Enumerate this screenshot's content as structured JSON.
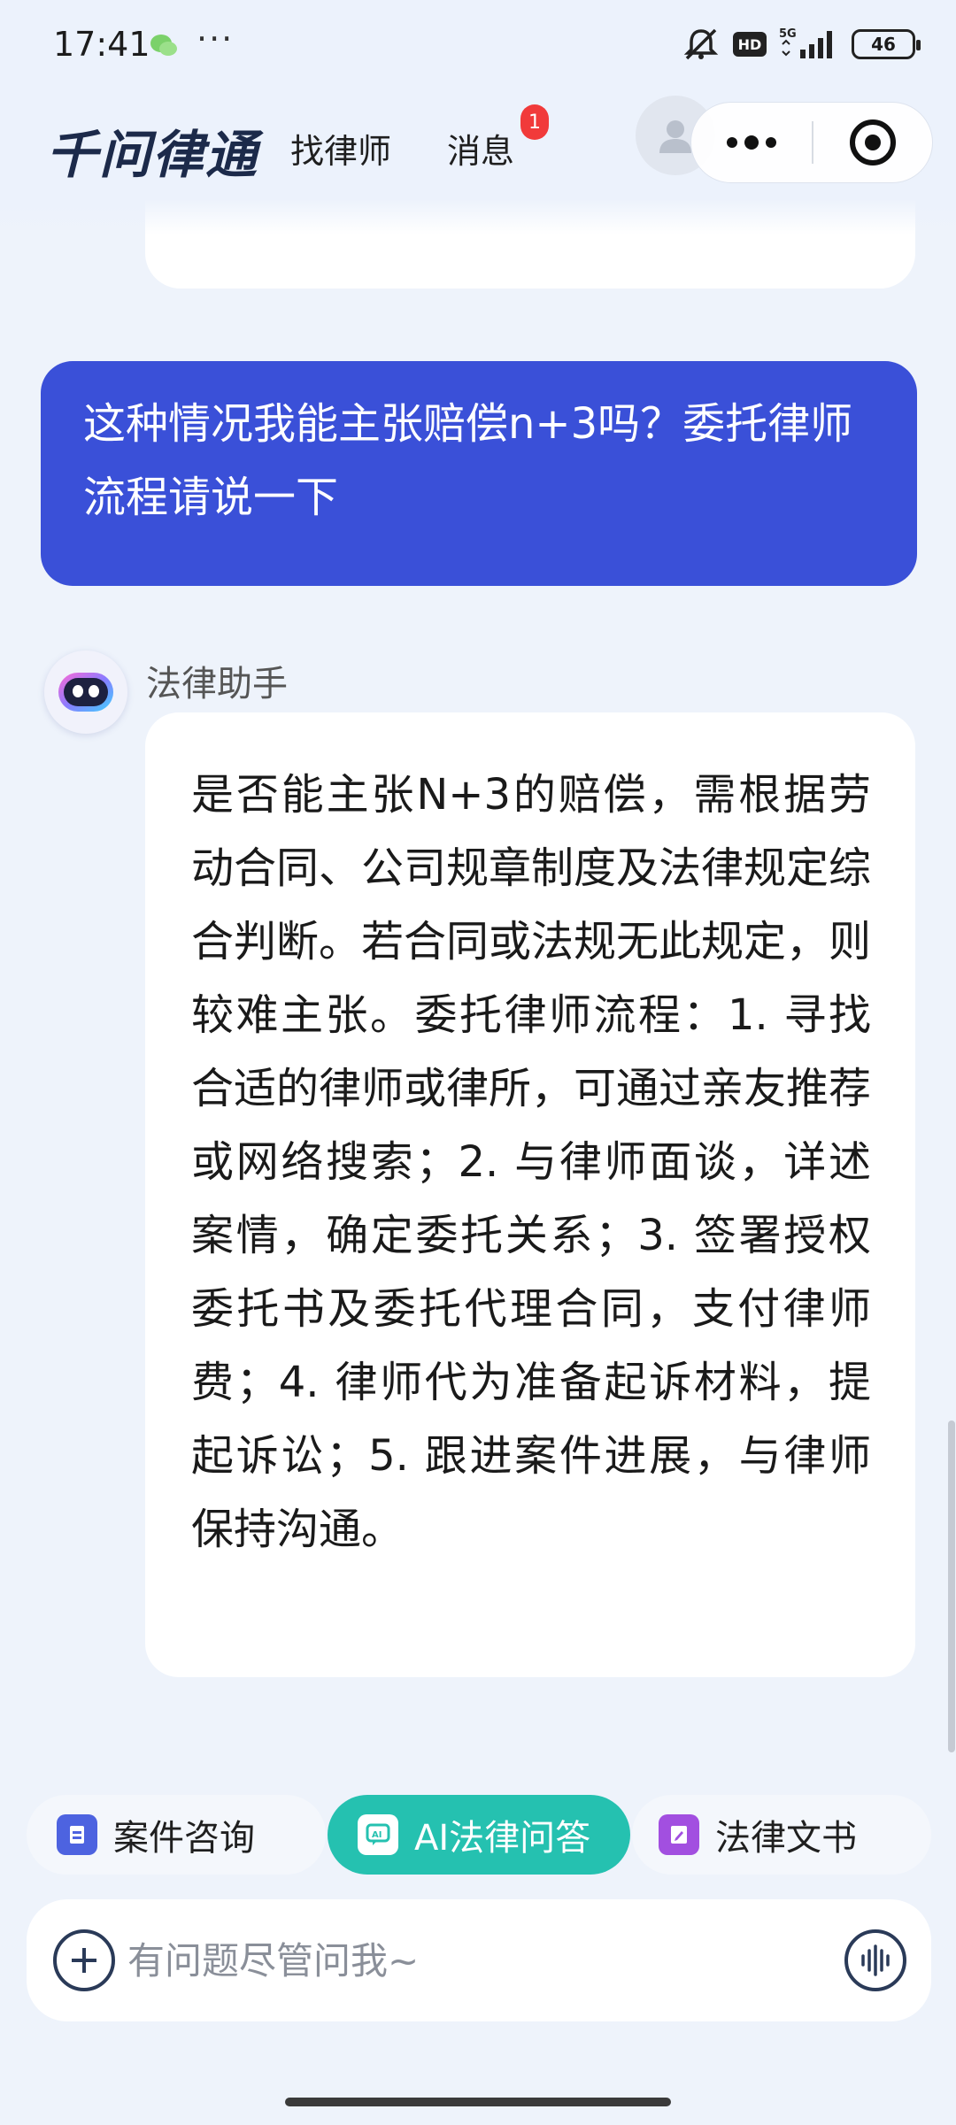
{
  "status_bar": {
    "time": "17:41",
    "dots": "···",
    "network": "5G",
    "hd": "HD",
    "battery": "46"
  },
  "header": {
    "brand": "千问律通",
    "nav_find": "找律师",
    "nav_messages": "消息",
    "message_badge": "1"
  },
  "chat": {
    "user_message": "这种情况我能主张赔偿n+3吗？委托律师流程请说一下",
    "assistant_name": "法律助手",
    "assistant_message": "是否能主张N+3的赔偿，需根据劳动合同、公司规章制度及法律规定综合判断。若合同或法规无此规定，则较难主张。委托律师流程：1. 寻找合适的律师或律所，可通过亲友推荐或网络搜索；2. 与律师面谈，详述案情，确定委托关系；3. 签署授权委托书及委托代理合同，支付律师费；4. 律师代为准备起诉材料，提起诉讼；5. 跟进案件进展，与律师保持沟通。"
  },
  "tabs": [
    {
      "label": "案件咨询",
      "icon": "document-icon",
      "active": false
    },
    {
      "label": "AI法律问答",
      "icon": "ai-chat-icon",
      "active": true
    },
    {
      "label": "法律文书",
      "icon": "edit-document-icon",
      "active": false
    }
  ],
  "input": {
    "placeholder": "有问题尽管问我~"
  },
  "colors": {
    "user_bubble": "#3a50d8",
    "active_tab": "#25c1b0",
    "badge": "#f13a3a",
    "brand": "#1c2a4a"
  }
}
